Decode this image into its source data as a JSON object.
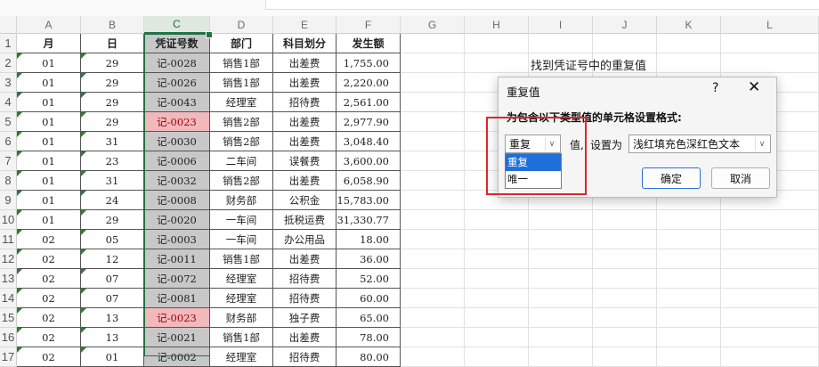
{
  "columns": [
    "A",
    "B",
    "C",
    "D",
    "E",
    "F",
    "G",
    "H",
    "I",
    "J",
    "K",
    "L"
  ],
  "selected_column": "C",
  "row_numbers": [
    "1",
    "2",
    "3",
    "4",
    "5",
    "6",
    "7",
    "8",
    "9",
    "10",
    "11",
    "12",
    "13",
    "14",
    "15",
    "16",
    "17"
  ],
  "headers": [
    "月",
    "日",
    "凭证号数",
    "部门",
    "科目划分",
    "发生额"
  ],
  "rows": [
    [
      "01",
      "29",
      "记-0028",
      "销售1部",
      "出差费",
      "1,755.00"
    ],
    [
      "01",
      "29",
      "记-0026",
      "销售1部",
      "出差费",
      "2,220.00"
    ],
    [
      "01",
      "29",
      "记-0043",
      "经理室",
      "招待费",
      "2,561.00"
    ],
    [
      "01",
      "29",
      "记-0023",
      "销售2部",
      "出差费",
      "2,977.90"
    ],
    [
      "01",
      "31",
      "记-0030",
      "销售2部",
      "出差费",
      "3,048.40"
    ],
    [
      "01",
      "23",
      "记-0006",
      "二车间",
      "误餐费",
      "3,600.00"
    ],
    [
      "01",
      "31",
      "记-0032",
      "销售2部",
      "出差费",
      "6,058.90"
    ],
    [
      "01",
      "24",
      "记-0008",
      "财务部",
      "公积金",
      "15,783.00"
    ],
    [
      "01",
      "29",
      "记-0020",
      "一车间",
      "抵税运费",
      "31,330.77"
    ],
    [
      "02",
      "05",
      "记-0003",
      "一车间",
      "办公用品",
      "18.00"
    ],
    [
      "02",
      "12",
      "记-0011",
      "销售1部",
      "出差费",
      "36.00"
    ],
    [
      "02",
      "07",
      "记-0072",
      "经理室",
      "招待费",
      "52.00"
    ],
    [
      "02",
      "07",
      "记-0081",
      "经理室",
      "招待费",
      "60.00"
    ],
    [
      "02",
      "13",
      "记-0023",
      "财务部",
      "独子费",
      "65.00"
    ],
    [
      "02",
      "13",
      "记-0021",
      "销售1部",
      "出差费",
      "78.00"
    ],
    [
      "02",
      "01",
      "记-0002",
      "经理室",
      "招待费",
      "80.00"
    ]
  ],
  "duplicate_rows": [
    3,
    13
  ],
  "note": "找到凭证号中的重复值",
  "dialog": {
    "title": "重复值",
    "help": "?",
    "close": "✕",
    "prompt": "为包含以下类型值的单元格设置格式:",
    "type_value": "重复",
    "label_value": "值,",
    "label_set": "设置为",
    "format_value": "浅红填充色深红色文本",
    "options": [
      "重复",
      "唯一"
    ],
    "ok": "确定",
    "cancel": "取消"
  },
  "colors": {
    "duplicate_fill": "#f2b9bd",
    "duplicate_text": "#9c0006",
    "selected_fill": "#c8c8c8",
    "accent": "#217346",
    "highlight_box": "#e0262b"
  }
}
